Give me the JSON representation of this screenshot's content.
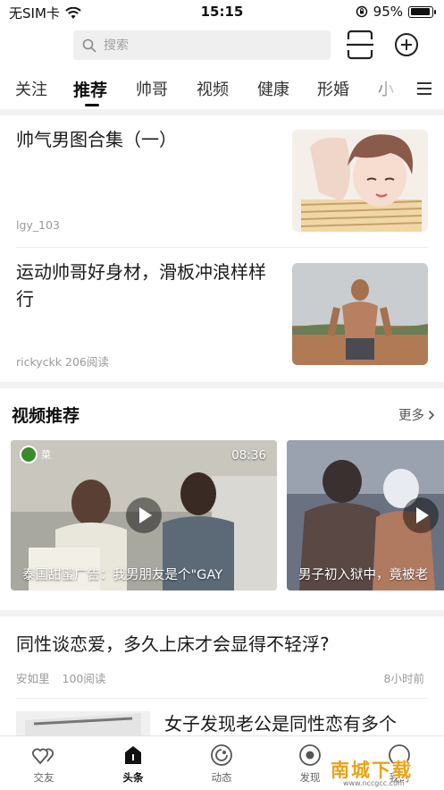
{
  "status_bar": {
    "carrier": "无SIM卡",
    "time": "15:15",
    "battery": "95%",
    "battery_level": 0.95
  },
  "search": {
    "placeholder": "搜索"
  },
  "tabs": [
    {
      "label": "关注"
    },
    {
      "label": "推荐"
    },
    {
      "label": "帅哥"
    },
    {
      "label": "视频"
    },
    {
      "label": "健康"
    },
    {
      "label": "形婚"
    },
    {
      "label": "小"
    }
  ],
  "articles": [
    {
      "title": "帅气男图合集（一）",
      "meta": "lgy_103"
    },
    {
      "title": "运动帅哥好身材，滑板冲浪样样行",
      "meta": "rickyckk 206阅读"
    }
  ],
  "video_section": {
    "title": "视频推荐",
    "more_label": "更多",
    "videos": [
      {
        "caption": "泰国甜蜜广告：我男朋友是个\"GAY",
        "duration": "08:36",
        "channel": "菜"
      },
      {
        "caption": "男子初入狱中，竟被老"
      }
    ]
  },
  "article3": {
    "title": "同性谈恋爱，多久上床才会显得不轻浮?",
    "author": "安如里",
    "reads": "100阅读",
    "time": "8小时前"
  },
  "article4": {
    "title": "女子发现老公是同性恋有多个"
  },
  "bottom_nav": [
    {
      "label": "交友"
    },
    {
      "label": "头条"
    },
    {
      "label": "动态"
    },
    {
      "label": "发现"
    },
    {
      "label": "我的"
    }
  ],
  "watermark": {
    "main": "南城下载",
    "sub": "www.nccgcc.com"
  },
  "colors": {
    "accent_watermark": "#e8a417",
    "divider": "#f2f2f2",
    "meta_text": "#9a9a9a"
  }
}
